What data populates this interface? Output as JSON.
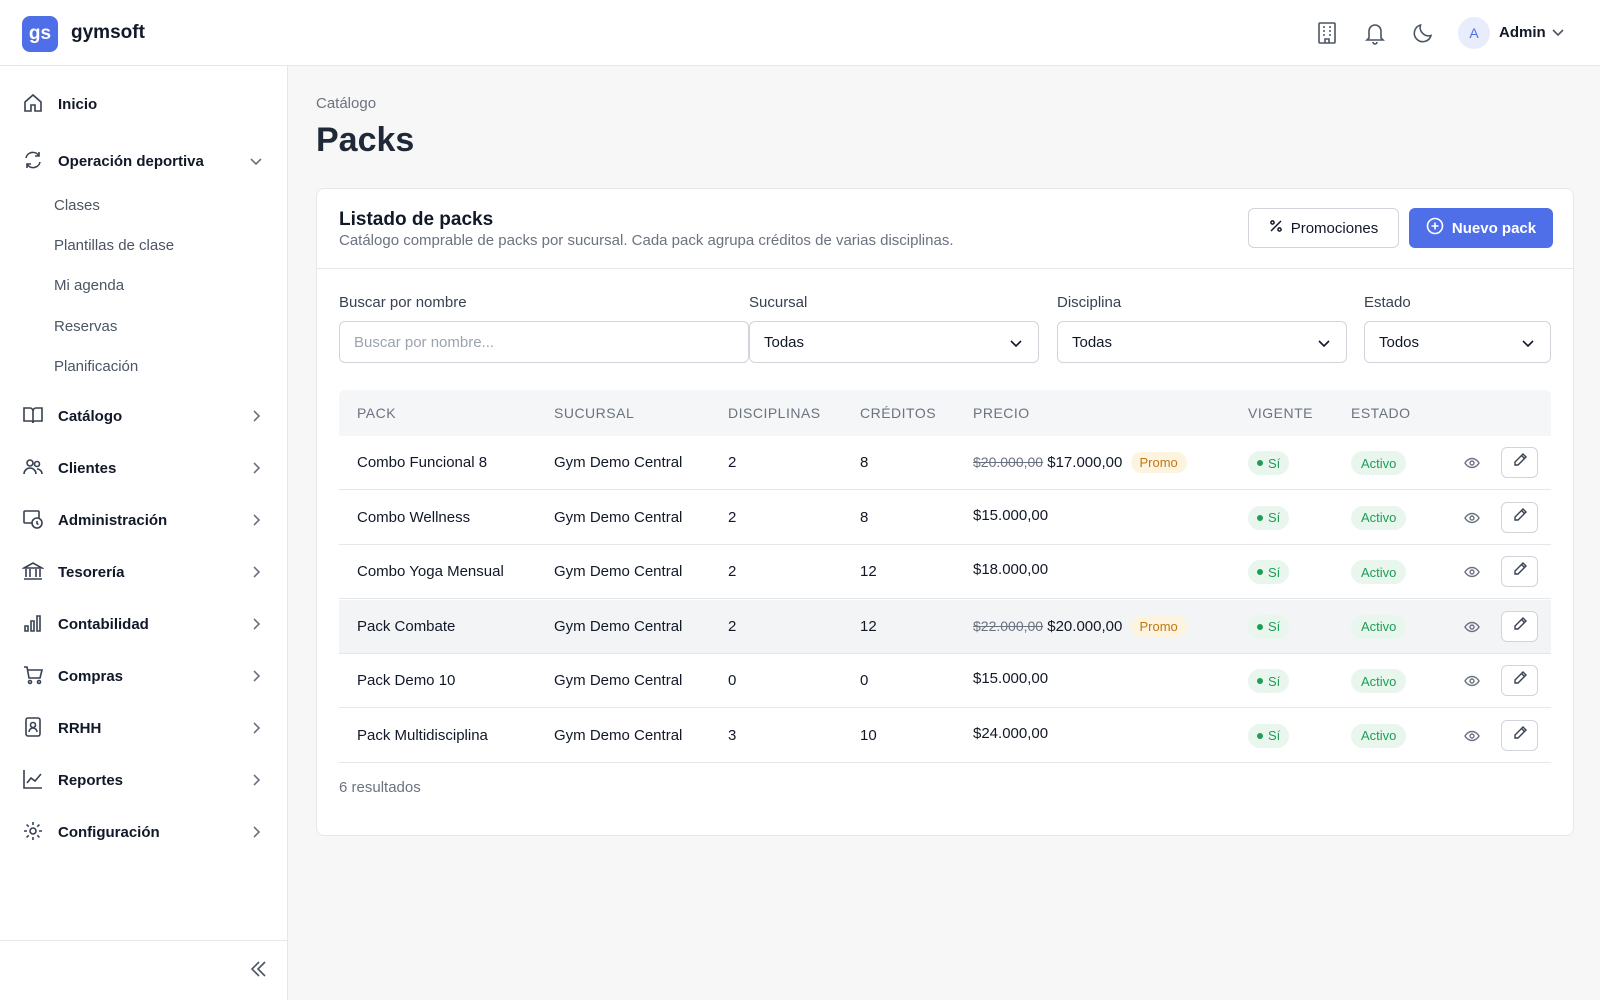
{
  "app": {
    "logo_text": "gs",
    "name": "gymsoft"
  },
  "header": {
    "user_initial": "A",
    "user_name": "Admin"
  },
  "sidebar": {
    "items": [
      {
        "label": "Inicio",
        "icon": "home-icon"
      },
      {
        "label": "Operación deportiva",
        "icon": "refresh-icon",
        "expanded": true,
        "children": [
          "Clases",
          "Plantillas de clase",
          "Mi agenda",
          "Reservas",
          "Planificación"
        ]
      },
      {
        "label": "Catálogo",
        "icon": "book-icon"
      },
      {
        "label": "Clientes",
        "icon": "users-icon"
      },
      {
        "label": "Administración",
        "icon": "admin-icon"
      },
      {
        "label": "Tesorería",
        "icon": "bank-icon"
      },
      {
        "label": "Contabilidad",
        "icon": "bar-chart-icon"
      },
      {
        "label": "Compras",
        "icon": "cart-icon"
      },
      {
        "label": "RRHH",
        "icon": "badge-icon"
      },
      {
        "label": "Reportes",
        "icon": "line-chart-icon"
      },
      {
        "label": "Configuración",
        "icon": "gear-icon"
      }
    ]
  },
  "page": {
    "breadcrumb": "Catálogo",
    "title": "Packs"
  },
  "card": {
    "title": "Listado de packs",
    "subtitle": "Catálogo comprable de packs por sucursal. Cada pack agrupa créditos de varias disciplinas.",
    "promo_button": "Promociones",
    "new_button": "Nuevo pack"
  },
  "filters": {
    "search_label": "Buscar por nombre",
    "search_placeholder": "Buscar por nombre...",
    "branch_label": "Sucursal",
    "branch_value": "Todas",
    "discipline_label": "Disciplina",
    "discipline_value": "Todas",
    "status_label": "Estado",
    "status_value": "Todos"
  },
  "table": {
    "headers": [
      "PACK",
      "SUCURSAL",
      "DISCIPLINAS",
      "CRÉDITOS",
      "PRECIO",
      "VIGENTE",
      "ESTADO"
    ],
    "rows": [
      {
        "pack": "Combo Funcional 8",
        "branch": "Gym Demo Central",
        "disciplines": "2",
        "credits": "8",
        "old_price": "$20.000,00",
        "price": "$17.000,00",
        "promo": "Promo",
        "current": "Sí",
        "status": "Activo"
      },
      {
        "pack": "Combo Wellness",
        "branch": "Gym Demo Central",
        "disciplines": "2",
        "credits": "8",
        "old_price": "",
        "price": "$15.000,00",
        "promo": "",
        "current": "Sí",
        "status": "Activo"
      },
      {
        "pack": "Combo Yoga Mensual",
        "branch": "Gym Demo Central",
        "disciplines": "2",
        "credits": "12",
        "old_price": "",
        "price": "$18.000,00",
        "promo": "",
        "current": "Sí",
        "status": "Activo"
      },
      {
        "pack": "Pack Combate",
        "branch": "Gym Demo Central",
        "disciplines": "2",
        "credits": "12",
        "old_price": "$22.000,00",
        "price": "$20.000,00",
        "promo": "Promo",
        "current": "Sí",
        "status": "Activo",
        "highlighted": true
      },
      {
        "pack": "Pack Demo 10",
        "branch": "Gym Demo Central",
        "disciplines": "0",
        "credits": "0",
        "old_price": "",
        "price": "$15.000,00",
        "promo": "",
        "current": "Sí",
        "status": "Activo"
      },
      {
        "pack": "Pack Multidisciplina",
        "branch": "Gym Demo Central",
        "disciplines": "3",
        "credits": "10",
        "old_price": "",
        "price": "$24.000,00",
        "promo": "",
        "current": "Sí",
        "status": "Activo"
      }
    ],
    "results_text": "6 resultados"
  },
  "colors": {
    "primary": "#4f6fe8",
    "success": "#1f9d57",
    "promo_text": "#c2780e",
    "promo_bg": "#fdf3e1"
  }
}
